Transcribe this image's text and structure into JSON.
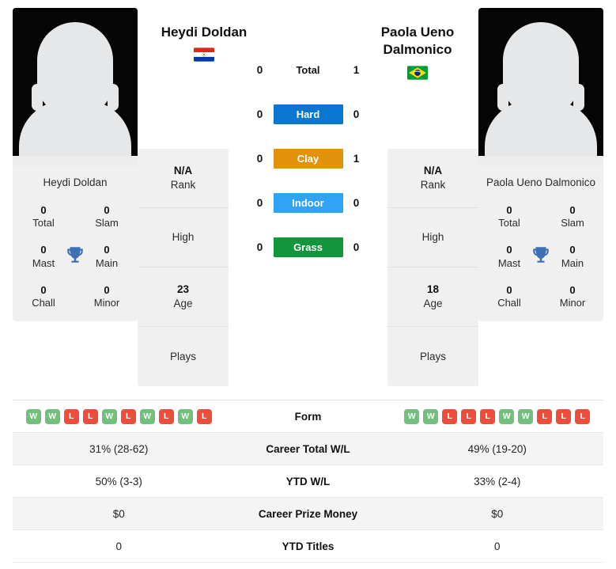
{
  "left_player": {
    "name": "Heydi Doldan",
    "card_name": "Heydi Doldan",
    "country": "Paraguay",
    "flag": "paraguay-flag",
    "rank": "N/A",
    "rank_label": "Rank",
    "high_value": "",
    "high_label": "High",
    "age": "23",
    "age_label": "Age",
    "plays_value": "",
    "plays_label": "Plays",
    "trophies": {
      "total": "0",
      "total_label": "Total",
      "slam": "0",
      "slam_label": "Slam",
      "mast": "0",
      "mast_label": "Mast",
      "main": "0",
      "main_label": "Main",
      "chall": "0",
      "chall_label": "Chall",
      "minor": "0",
      "minor_label": "Minor"
    },
    "form": [
      "W",
      "W",
      "L",
      "L",
      "W",
      "L",
      "W",
      "L",
      "W",
      "L"
    ],
    "career_total_wl": "31% (28-62)",
    "ytd_wl": "50% (3-3)",
    "career_prize_money": "$0",
    "ytd_titles": "0"
  },
  "right_player": {
    "name": "Paola Ueno Dalmonico",
    "card_name": "Paola Ueno Dalmonico",
    "country": "Brazil",
    "flag": "brazil-flag",
    "rank": "N/A",
    "rank_label": "Rank",
    "high_value": "",
    "high_label": "High",
    "age": "18",
    "age_label": "Age",
    "plays_value": "",
    "plays_label": "Plays",
    "trophies": {
      "total": "0",
      "total_label": "Total",
      "slam": "0",
      "slam_label": "Slam",
      "mast": "0",
      "mast_label": "Mast",
      "main": "0",
      "main_label": "Main",
      "chall": "0",
      "chall_label": "Chall",
      "minor": "0",
      "minor_label": "Minor"
    },
    "form": [
      "W",
      "W",
      "L",
      "L",
      "L",
      "W",
      "W",
      "L",
      "L",
      "L"
    ],
    "career_total_wl": "49% (19-20)",
    "ytd_wl": "33% (2-4)",
    "career_prize_money": "$0",
    "ytd_titles": "0"
  },
  "head_to_head": {
    "rows": [
      {
        "label": "Total",
        "left": "0",
        "right": "1",
        "color": "",
        "text_color": "#111111"
      },
      {
        "label": "Hard",
        "left": "0",
        "right": "0",
        "color": "#0b76d0",
        "text_color": "#ffffff"
      },
      {
        "label": "Clay",
        "left": "0",
        "right": "1",
        "color": "#e2920b",
        "text_color": "#ffffff"
      },
      {
        "label": "Indoor",
        "left": "0",
        "right": "0",
        "color": "#30a3f5",
        "text_color": "#ffffff"
      },
      {
        "label": "Grass",
        "left": "0",
        "right": "0",
        "color": "#12963c",
        "text_color": "#ffffff"
      }
    ]
  },
  "stats_table": {
    "form_label": "Form",
    "rows": [
      {
        "label": "Career Total W/L",
        "left": "31% (28-62)",
        "right": "49% (19-20)"
      },
      {
        "label": "YTD W/L",
        "left": "50% (3-3)",
        "right": "33% (2-4)"
      },
      {
        "label": "Career Prize Money",
        "left": "$0",
        "right": "$0"
      },
      {
        "label": "YTD Titles",
        "left": "0",
        "right": "0"
      }
    ]
  },
  "colors": {
    "hard": "#0b76d0",
    "clay": "#e2920b",
    "indoor": "#30a3f5",
    "grass": "#12963c",
    "win": "#73bf7e",
    "loss": "#ef4d3c",
    "card_bg": "#f0f0f0"
  }
}
